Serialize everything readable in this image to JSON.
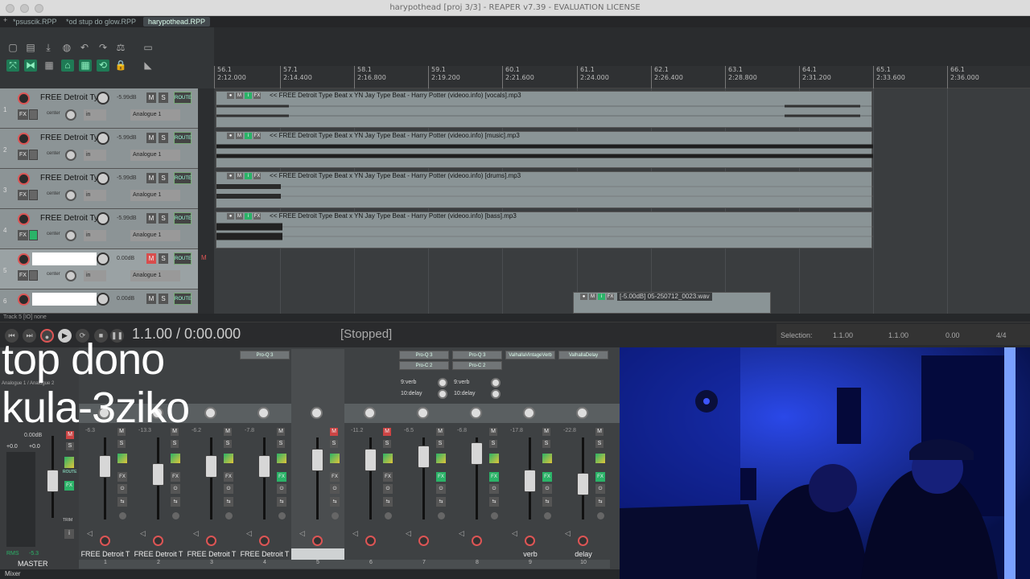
{
  "window": {
    "title": "harypothead [proj 3/3] - REAPER v7.39 - EVALUATION LICENSE"
  },
  "tabs": [
    {
      "label": "*psuscik.RPP"
    },
    {
      "label": "*od stup do glow.RPP"
    },
    {
      "label": "harypothead.RPP"
    }
  ],
  "ruler": [
    {
      "bar": "56.1",
      "time": "2:12.000"
    },
    {
      "bar": "57.1",
      "time": "2:14.400"
    },
    {
      "bar": "58.1",
      "time": "2:16.800"
    },
    {
      "bar": "59.1",
      "time": "2:19.200"
    },
    {
      "bar": "60.1",
      "time": "2:21.600"
    },
    {
      "bar": "61.1",
      "time": "2:24.000"
    },
    {
      "bar": "62.1",
      "time": "2:26.400"
    },
    {
      "bar": "63.1",
      "time": "2:28.800"
    },
    {
      "bar": "64.1",
      "time": "2:31.200"
    },
    {
      "bar": "65.1",
      "time": "2:33.600"
    },
    {
      "bar": "66.1",
      "time": "2:36.000"
    }
  ],
  "tracks": [
    {
      "num": "1",
      "name": "FREE Detroit Ty",
      "vol": "-5.99dB",
      "pan": "center",
      "in": "in",
      "input": "Analogue 1",
      "fx_on": false
    },
    {
      "num": "2",
      "name": "FREE Detroit Ty",
      "vol": "-5.99dB",
      "pan": "center",
      "in": "in",
      "input": "Analogue 1",
      "fx_on": false
    },
    {
      "num": "3",
      "name": "FREE Detroit Ty",
      "vol": "-5.99dB",
      "pan": "center",
      "in": "in",
      "input": "Analogue 1",
      "fx_on": false
    },
    {
      "num": "4",
      "name": "FREE Detroit Ty",
      "vol": "-5.99dB",
      "pan": "center",
      "in": "in",
      "input": "Analogue 1",
      "fx_on": true
    },
    {
      "num": "5",
      "name": "",
      "vol": "0.00dB",
      "pan": "center",
      "in": "in",
      "input": "Analogue 1",
      "fx_on": false
    },
    {
      "num": "6",
      "name": "",
      "vol": "0.00dB",
      "pan": "",
      "in": "",
      "input": "",
      "fx_on": false
    }
  ],
  "items": [
    {
      "label": "<< FREE Detroit Type Beat x YN Jay Type Beat - Harry Potter (videoo.info) [vocals].mp3"
    },
    {
      "label": "<< FREE Detroit Type Beat x YN Jay Type Beat - Harry Potter (videoo.info) [music].mp3"
    },
    {
      "label": "<< FREE Detroit Type Beat x YN Jay Type Beat - Harry Potter (videoo.info) [drums].mp3"
    },
    {
      "label": "<< FREE Detroit Type Beat x YN Jay Type Beat - Harry Potter (videoo.info) [bass].mp3"
    }
  ],
  "extra_item": {
    "label": "[-5.00dB] 05-250712_0023.wav"
  },
  "status_line": "Track 5 [IO] none",
  "transport": {
    "time": "1.1.00 / 0:00.000",
    "state": "[Stopped]"
  },
  "selection": {
    "label": "Selection:",
    "start": "1.1.00",
    "end": "1.1.00",
    "length": "0.00",
    "sig": "4/4"
  },
  "master": {
    "label": "MASTER",
    "vol": "+0.0",
    "peak": "+0.0",
    "db": "0.00dB",
    "rms": "RMS",
    "rms_val": "-5.3",
    "input_label": "Analogue 1 / Analogue 2",
    "center": "center",
    "route": "ROUTE",
    "trim": "TRIM"
  },
  "mixer_strips": [
    {
      "num": "1",
      "name": "FREE Detroit T",
      "vol": "-6.3",
      "fx": [],
      "sends": []
    },
    {
      "num": "2",
      "name": "FREE Detroit T",
      "vol": "-13.3",
      "fx": [],
      "sends": []
    },
    {
      "num": "3",
      "name": "FREE Detroit T",
      "vol": "-6.2",
      "fx": [],
      "sends": []
    },
    {
      "num": "4",
      "name": "FREE Detroit T",
      "vol": "-7.8",
      "fx": [
        "Pro-Q 3"
      ],
      "sends": []
    },
    {
      "num": "5",
      "name": "",
      "vol": "",
      "fx": [],
      "sends": []
    },
    {
      "num": "6",
      "name": "",
      "vol": "-11.2",
      "fx": [],
      "sends": []
    },
    {
      "num": "7",
      "name": "",
      "vol": "-6.5",
      "fx": [
        "Pro-Q 3",
        "Pro-C 2"
      ],
      "sends": [
        "9:verb",
        "10:delay"
      ]
    },
    {
      "num": "8",
      "name": "",
      "vol": "-6.8",
      "fx": [
        "Pro-Q 3",
        "Pro-C 2"
      ],
      "sends": [
        "9:verb",
        "10:delay"
      ]
    },
    {
      "num": "9",
      "name": "verb",
      "vol": "-17.8",
      "fx": [
        "ValhallaVintageVerb"
      ],
      "sends": []
    },
    {
      "num": "10",
      "name": "delay",
      "vol": "-22.8",
      "fx": [
        "ValhallaDelay"
      ],
      "sends": []
    }
  ],
  "mixer_tab": "Mixer",
  "overlay": {
    "line1": "top dono",
    "line2": "kula-3ziko"
  },
  "colors": {
    "accent_green": "#2bb368",
    "record_red": "#d84d4d",
    "item_bg": "#8a9496"
  }
}
